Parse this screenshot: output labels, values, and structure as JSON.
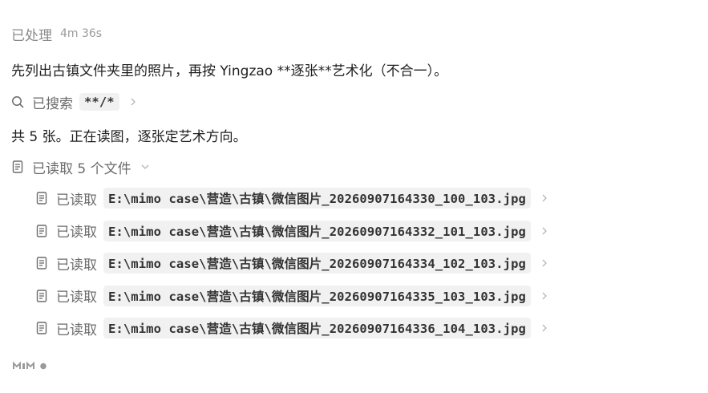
{
  "status": {
    "label": "已处理",
    "time": "4m 36s"
  },
  "messages": [
    "先列出古镇文件夹里的照片，再按 Yingzao **逐张**艺术化（不合一）。",
    "共 5 张。正在读图，逐张定艺术方向。"
  ],
  "search": {
    "label": "已搜索",
    "pattern": "**/*"
  },
  "read_group": {
    "label": "已读取 5 个文件"
  },
  "files": [
    {
      "label": "已读取",
      "path": "E:\\mimo case\\营造\\古镇\\微信图片_20260907164330_100_103.jpg"
    },
    {
      "label": "已读取",
      "path": "E:\\mimo case\\营造\\古镇\\微信图片_20260907164332_101_103.jpg"
    },
    {
      "label": "已读取",
      "path": "E:\\mimo case\\营造\\古镇\\微信图片_20260907164334_102_103.jpg"
    },
    {
      "label": "已读取",
      "path": "E:\\mimo case\\营造\\古镇\\微信图片_20260907164335_103_103.jpg"
    },
    {
      "label": "已读取",
      "path": "E:\\mimo case\\营造\\古镇\\微信图片_20260907164336_104_103.jpg"
    }
  ],
  "icons": {
    "search": "search-icon",
    "document": "document-icon",
    "chevron_right": "chevron-right-icon",
    "chevron_down": "chevron-down-icon",
    "logo": "mimo-logo"
  },
  "colors": {
    "text": "#1f1f1f",
    "muted": "#6b6b6b",
    "status": "#8a8a8a",
    "code_bg": "#f1f1f1"
  }
}
